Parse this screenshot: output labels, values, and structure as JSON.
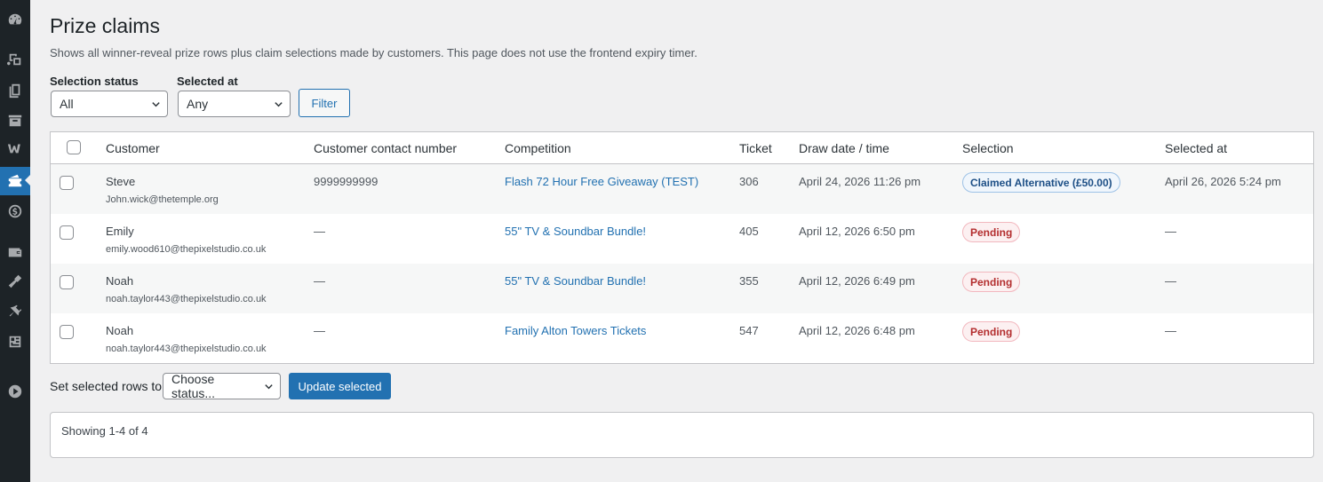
{
  "sidebar": {
    "items": [
      {
        "icon": "dashboard-icon"
      },
      {
        "icon": "media-icon"
      },
      {
        "icon": "pages-icon"
      },
      {
        "icon": "archive-icon"
      },
      {
        "icon": "woocommerce-icon"
      },
      {
        "icon": "tickets-icon",
        "active": true
      },
      {
        "icon": "dollar-icon"
      },
      {
        "icon": "wallet-icon"
      },
      {
        "icon": "appearance-icon"
      },
      {
        "icon": "plugins-icon"
      },
      {
        "icon": "tools-icon"
      },
      {
        "icon": "play-icon"
      }
    ]
  },
  "page": {
    "title": "Prize claims",
    "description": "Shows all winner-reveal prize rows plus claim selections made by customers. This page does not use the frontend expiry timer."
  },
  "filters": {
    "status_label": "Selection status",
    "status_value": "All",
    "selected_at_label": "Selected at",
    "selected_at_value": "Any",
    "filter_button": "Filter"
  },
  "table": {
    "columns": [
      "Customer",
      "Customer contact number",
      "Competition",
      "Ticket",
      "Draw date / time",
      "Selection",
      "Selected at"
    ],
    "rows": [
      {
        "name": "Steve",
        "email": "John.wick@thetemple.org",
        "phone": "9999999999",
        "competition": "Flash 72 Hour Free Giveaway (TEST)",
        "ticket": "306",
        "draw": "April 24, 2026 11:26 pm",
        "selection": "Claimed Alternative (£50.00)",
        "selection_type": "claimed",
        "selected_at": "April 26, 2026 5:24 pm"
      },
      {
        "name": "Emily",
        "email": "emily.wood610@thepixelstudio.co.uk",
        "phone": "—",
        "competition": "55\" TV & Soundbar Bundle!",
        "ticket": "405",
        "draw": "April 12, 2026 6:50 pm",
        "selection": "Pending",
        "selection_type": "pending",
        "selected_at": "—"
      },
      {
        "name": "Noah",
        "email": "noah.taylor443@thepixelstudio.co.uk",
        "phone": "—",
        "competition": "55\" TV & Soundbar Bundle!",
        "ticket": "355",
        "draw": "April 12, 2026 6:49 pm",
        "selection": "Pending",
        "selection_type": "pending",
        "selected_at": "—"
      },
      {
        "name": "Noah",
        "email": "noah.taylor443@thepixelstudio.co.uk",
        "phone": "—",
        "competition": "Family Alton Towers Tickets",
        "ticket": "547",
        "draw": "April 12, 2026 6:48 pm",
        "selection": "Pending",
        "selection_type": "pending",
        "selected_at": "—"
      }
    ]
  },
  "bulk": {
    "label": "Set selected rows to",
    "select_value": "Choose status...",
    "button": "Update selected"
  },
  "footer": {
    "showing": "Showing 1-4 of 4"
  },
  "colors": {
    "accent": "#2271b1",
    "sidebar_bg": "#1d2327",
    "page_bg": "#f0f0f1",
    "pending": "#b32d2e"
  }
}
